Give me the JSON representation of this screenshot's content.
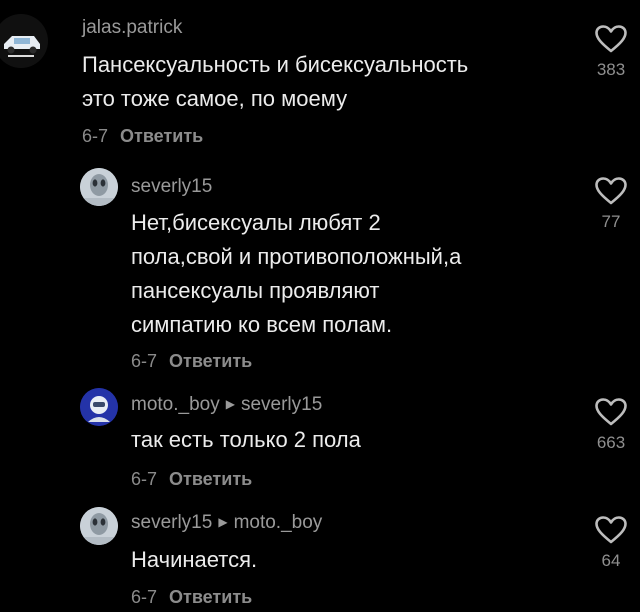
{
  "icons": {
    "like": "heart-outline-icon",
    "reply_arrow": "triangle-right-icon"
  },
  "colors": {
    "background": "#000000",
    "username": "#9a9a9a",
    "text": "#ececec",
    "meta": "#8a8a8a"
  },
  "comments": [
    {
      "username": "jalas.patrick",
      "text_lines": [
        "Пансексуальность и бисексуальность",
        "это тоже самое, по моему"
      ],
      "date": "6-7",
      "reply_label": "Ответить",
      "likes": "383"
    },
    {
      "username": "severly15",
      "text_lines": [
        "Нет,бисексуалы любят 2",
        "пола,свой и противоположный,а",
        "пансексуалы проявляют",
        "симпатию ко всем полам."
      ],
      "date": "6-7",
      "reply_label": "Ответить",
      "likes": "77"
    },
    {
      "username": "moto._boy",
      "reply_to": "severly15",
      "text_lines": [
        "так есть только 2 пола"
      ],
      "date": "6-7",
      "reply_label": "Ответить",
      "likes": "663"
    },
    {
      "username": "severly15",
      "reply_to": "moto._boy",
      "text_lines": [
        "Начинается."
      ],
      "date": "6-7",
      "reply_label": "Ответить",
      "likes": "64"
    }
  ]
}
